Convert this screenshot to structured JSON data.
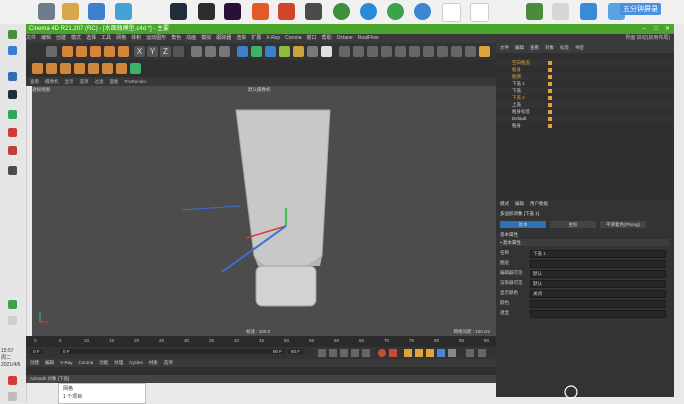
{
  "taskbar": {
    "tray_label": "五分钟屏录"
  },
  "left_strip": {
    "time": "15:57",
    "weekday": "周二",
    "date": "2021/4/6"
  },
  "window": {
    "title": "Cinema 4D R21.207 (RC) - [水面瓶模型.c4d *] - 主要",
    "menu_items": [
      "文件",
      "编辑",
      "创建",
      "模式",
      "选择",
      "工具",
      "网格",
      "体积",
      "运动图形",
      "角色",
      "动画",
      "模拟",
      "跟踪器",
      "渲染",
      "扩展",
      "X-Ray",
      "Corona",
      "窗口",
      "帮助",
      "Octane",
      "RealFlow"
    ],
    "right_menu": "界面 启动(启用布局)"
  },
  "viewport": {
    "menu_items": [
      "查看",
      "摄像机",
      "显示",
      "选项",
      "过滤",
      "面板",
      "ProRender"
    ],
    "label_left": "透视视图",
    "label_center": "默认摄像机",
    "footer_left": "网格间距 : 100 cm",
    "footer_center": "帧速 : 100.0"
  },
  "timeline": {
    "ticks": [
      "0",
      "5",
      "10",
      "15",
      "20",
      "25",
      "30",
      "35",
      "40",
      "45",
      "50",
      "55",
      "60",
      "65",
      "70",
      "75",
      "80",
      "85",
      "90"
    ],
    "current_frame": "0 F",
    "start_frame": "0 F",
    "end_frame": "90 F",
    "max_frame": "90 F",
    "frame_field": "0 F"
  },
  "material_menu": [
    "创建",
    "编辑",
    "X-Ray",
    "Corona",
    "功能",
    "纹理",
    "Cycles",
    "材质",
    "选项"
  ],
  "status": "Azimuth 对象 [下盖]",
  "popup": {
    "line1": "网格",
    "line2": "1 个项目"
  },
  "object_manager": {
    "tabs": [
      "文件",
      "编辑",
      "查看",
      "对象",
      "标签",
      "书签"
    ],
    "rows": [
      {
        "name": "空白瓶盖",
        "color": "#e0a23a"
      },
      {
        "name": "瓶身",
        "color": "#e0a23a"
      },
      {
        "name": "瓶颈",
        "color": "#e0a23a"
      },
      {
        "name": "下盖 1",
        "color": "#d5d5d5"
      },
      {
        "name": "下盖",
        "color": "#d5d5d5"
      },
      {
        "name": "下盖 2",
        "color": "#e0a23a"
      },
      {
        "name": "上盖",
        "color": "#d5d5d5"
      },
      {
        "name": "瓶身标签",
        "color": "#d5d5d5"
      },
      {
        "name": "Default",
        "color": "#d5d5d5"
      },
      {
        "name": "瓶身",
        "color": "#d5d5d5"
      }
    ]
  },
  "attributes": {
    "tabs": [
      "模式",
      "编辑",
      "用户数据"
    ],
    "title": "多边形对象 [下盖 1]",
    "sub_tabs": [
      "基本",
      "坐标",
      "平滑着色(Phong)"
    ],
    "section": "基本属性",
    "subsection": "• 基本属性",
    "fields": [
      {
        "label": "名称",
        "value": "下盖 1"
      },
      {
        "label": "图层",
        "value": ""
      },
      {
        "label": "编辑器可见",
        "value": "默认"
      },
      {
        "label": "渲染器可见",
        "value": "默认"
      },
      {
        "label": "显示颜色",
        "value": "关闭"
      },
      {
        "label": "颜色",
        "value": ""
      },
      {
        "label": "透显",
        "value": ""
      }
    ]
  }
}
